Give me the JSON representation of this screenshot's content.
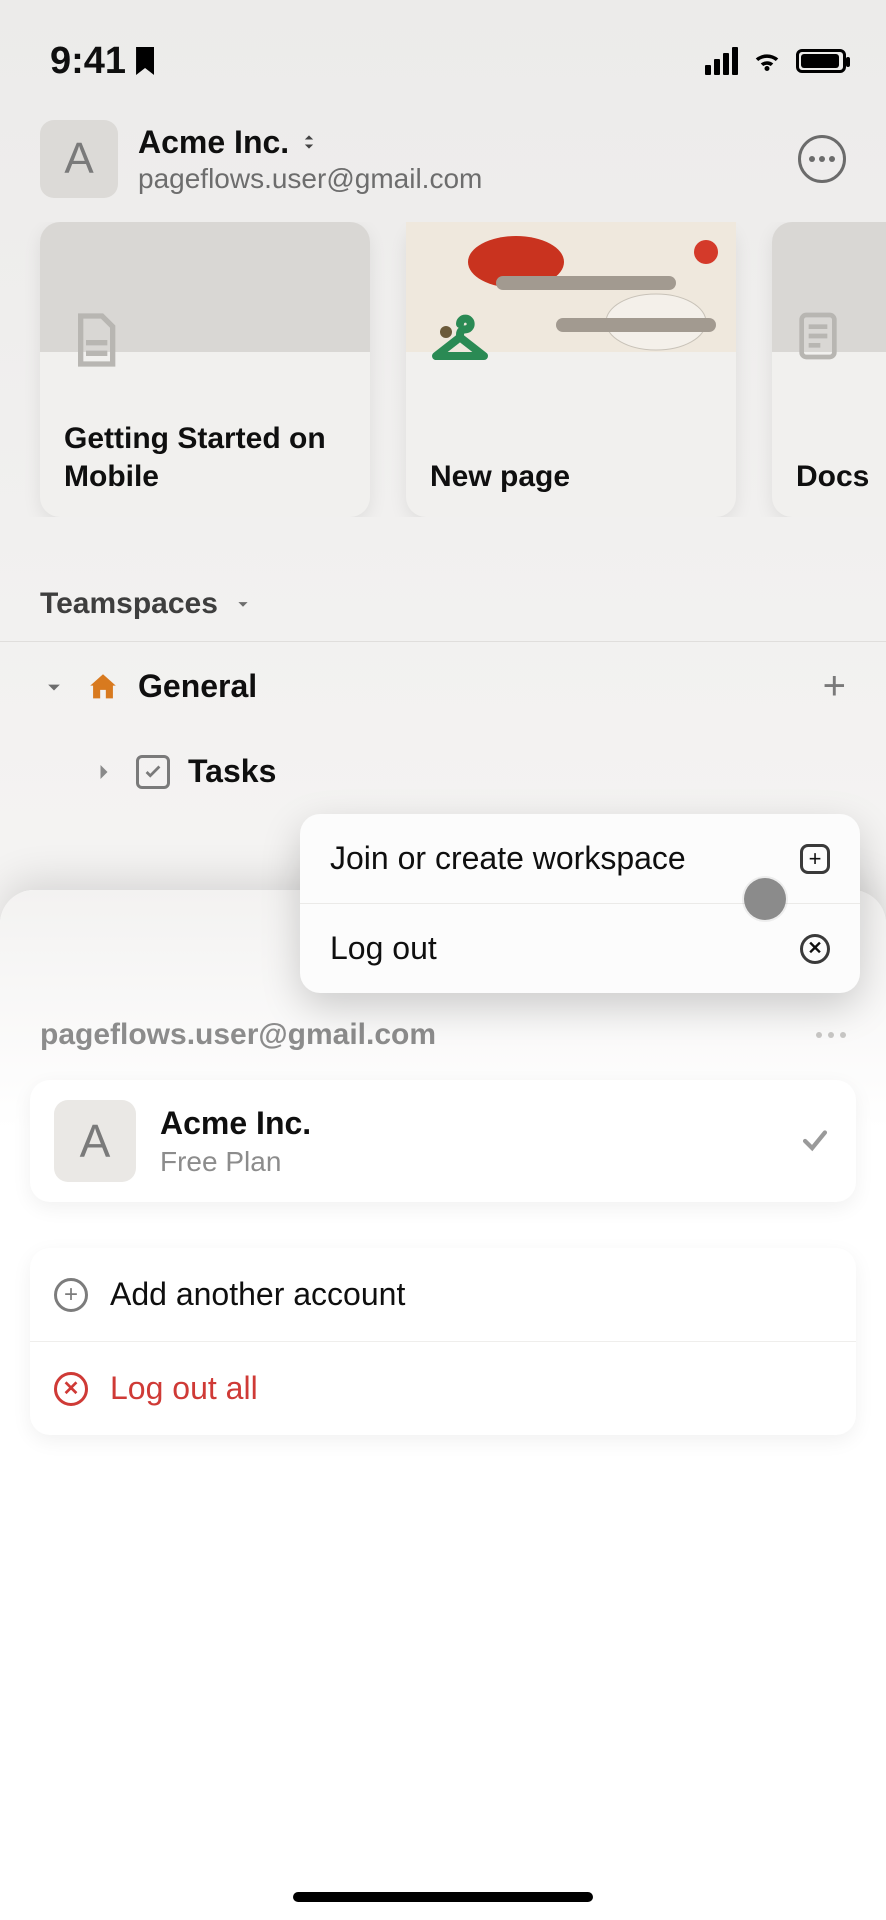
{
  "status_bar": {
    "time": "9:41"
  },
  "header": {
    "workspace_initial": "A",
    "workspace_name": "Acme Inc.",
    "email": "pageflows.user@gmail.com"
  },
  "recent_cards": [
    {
      "title": "Getting Started on Mobile"
    },
    {
      "title": "New page"
    },
    {
      "title": "Docs"
    }
  ],
  "sections": {
    "teamspaces_label": "Teamspaces"
  },
  "teamspace": {
    "name": "General",
    "pages": [
      {
        "title": "Tasks"
      }
    ]
  },
  "popover": {
    "join_label": "Join or create workspace",
    "logout_label": "Log out"
  },
  "account_sheet": {
    "email": "pageflows.user@gmail.com",
    "workspace": {
      "initial": "A",
      "name": "Acme Inc.",
      "plan": "Free Plan"
    },
    "add_account_label": "Add another account",
    "logout_all_label": "Log out all"
  }
}
